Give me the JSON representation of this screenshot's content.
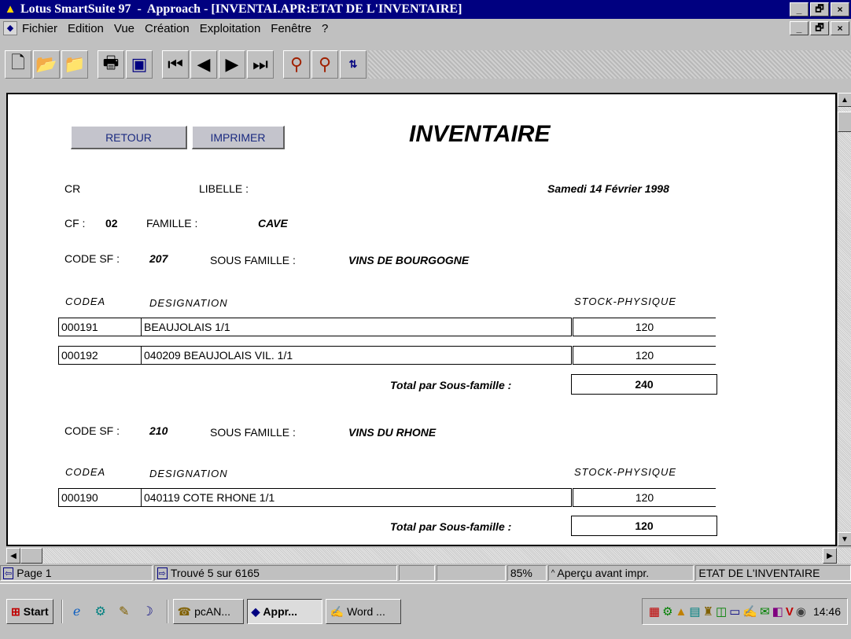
{
  "window": {
    "title_app": "Lotus SmartSuite 97",
    "title_rest": "  -  Approach - [INVENTAI.APR:ETAT DE L'INVENTAIRE]",
    "btn_min": "_",
    "btn_max": "🗗",
    "btn_close": "×"
  },
  "menu": {
    "items": [
      "Fichier",
      "Edition",
      "Vue",
      "Création",
      "Exploitation",
      "Fenêtre",
      "?"
    ]
  },
  "toolbar": {
    "icons": [
      "new-doc-icon",
      "open-folder-icon",
      "close-folder-icon",
      "print-icon",
      "preview-icon",
      "first-record-icon",
      "prev-record-icon",
      "next-record-icon",
      "last-record-icon",
      "find-icon",
      "find-all-icon",
      "sort-icon"
    ]
  },
  "report": {
    "btn_retour": "RETOUR",
    "btn_imprimer": "IMPRIMER",
    "title": "INVENTAIRE",
    "date": "Samedi 14 Février 1998",
    "cr_label": "CR",
    "libelle_label": "LIBELLE :",
    "cf_label": "CF :",
    "cf_value": "02",
    "famille_label": "FAMILLE :",
    "famille_value": "CAVE",
    "groups": [
      {
        "code_sf_label": "CODE SF :",
        "code_sf_value": "207",
        "sous_famille_label": "SOUS FAMILLE :",
        "sous_famille_value": "VINS DE BOURGOGNE",
        "col_codea": "CODEA",
        "col_designation": "DESIGNATION",
        "col_stock": "STOCK-PHYSIQUE",
        "rows": [
          {
            "codea": "000191",
            "designation": "BEAUJOLAIS 1/1",
            "stock": "120"
          },
          {
            "codea": "000192",
            "designation": "040209  BEAUJOLAIS VIL. 1/1",
            "stock": "120"
          }
        ],
        "total_label": "Total par Sous-famille  :",
        "total_value": "240"
      },
      {
        "code_sf_label": "CODE SF :",
        "code_sf_value": "210",
        "sous_famille_label": "SOUS FAMILLE :",
        "sous_famille_value": "VINS DU RHONE",
        "col_codea": "CODEA",
        "col_designation": "DESIGNATION",
        "col_stock": "STOCK-PHYSIQUE",
        "rows": [
          {
            "codea": "000190",
            "designation": "040119  COTE RHONE 1/1",
            "stock": "120"
          }
        ],
        "total_label": "Total par Sous-famille  :",
        "total_value": "120"
      }
    ]
  },
  "status": {
    "page": "Page 1",
    "found": "Trouvé 5 sur 6165",
    "zoom": "85%",
    "mode": "Aperçu avant impr.",
    "view": "ETAT DE L'INVENTAIRE"
  },
  "taskbar": {
    "start": "Start",
    "tasks": [
      "pcAN...",
      "Appr...",
      "Word ..."
    ],
    "clock": "14:46"
  }
}
